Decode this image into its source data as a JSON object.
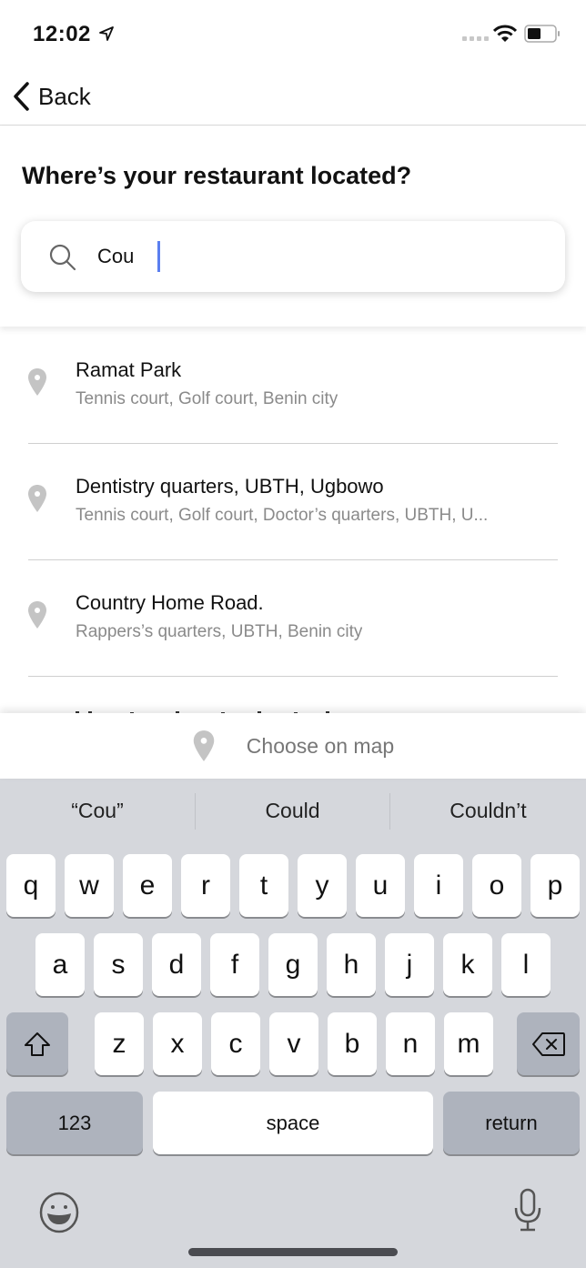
{
  "status_bar": {
    "time": "12:02",
    "icons": [
      "location-arrow-icon",
      "signal-icon",
      "wifi-icon",
      "battery-icon"
    ]
  },
  "nav": {
    "back_label": "Back",
    "back_icon": "chevron-left-icon"
  },
  "header": {
    "title": "Where’s your restaurant located?"
  },
  "search": {
    "value": "Cou",
    "icon": "search-icon",
    "caret_color": "#5b7ff0"
  },
  "results": [
    {
      "title": "Ramat Park",
      "subtitle": "Tennis court, Golf court, Benin city"
    },
    {
      "title": "Dentistry quarters, UBTH, Ugbowo",
      "subtitle": "Tennis court, Golf court, Doctor’s quarters, UBTH, U..."
    },
    {
      "title": "Country Home Road.",
      "subtitle": "Rappers’s quarters, UBTH, Benin city"
    }
  ],
  "choose_on_map": {
    "label": "Choose on map",
    "icon": "map-pin-icon"
  },
  "keyboard": {
    "suggestions": [
      "“Cou”",
      "Could",
      "Couldn’t"
    ],
    "row1": [
      "q",
      "w",
      "e",
      "r",
      "t",
      "y",
      "u",
      "i",
      "o",
      "p"
    ],
    "row2": [
      "a",
      "s",
      "d",
      "f",
      "g",
      "h",
      "j",
      "k",
      "l"
    ],
    "row3": [
      "z",
      "x",
      "c",
      "v",
      "b",
      "n",
      "m"
    ],
    "numbers_label": "123",
    "space_label": "space",
    "return_label": "return",
    "shift_icon": "shift-icon",
    "delete_icon": "backspace-icon",
    "emoji_icon": "emoji-icon",
    "mic_icon": "microphone-icon"
  },
  "colors": {
    "keyboard_bg": "#d5d7dc",
    "key_bg": "#ffffff",
    "key_dark_bg": "#aeb3bd",
    "subtitle_text": "#8a8a8a",
    "pin_gray": "#c4c4c4"
  }
}
